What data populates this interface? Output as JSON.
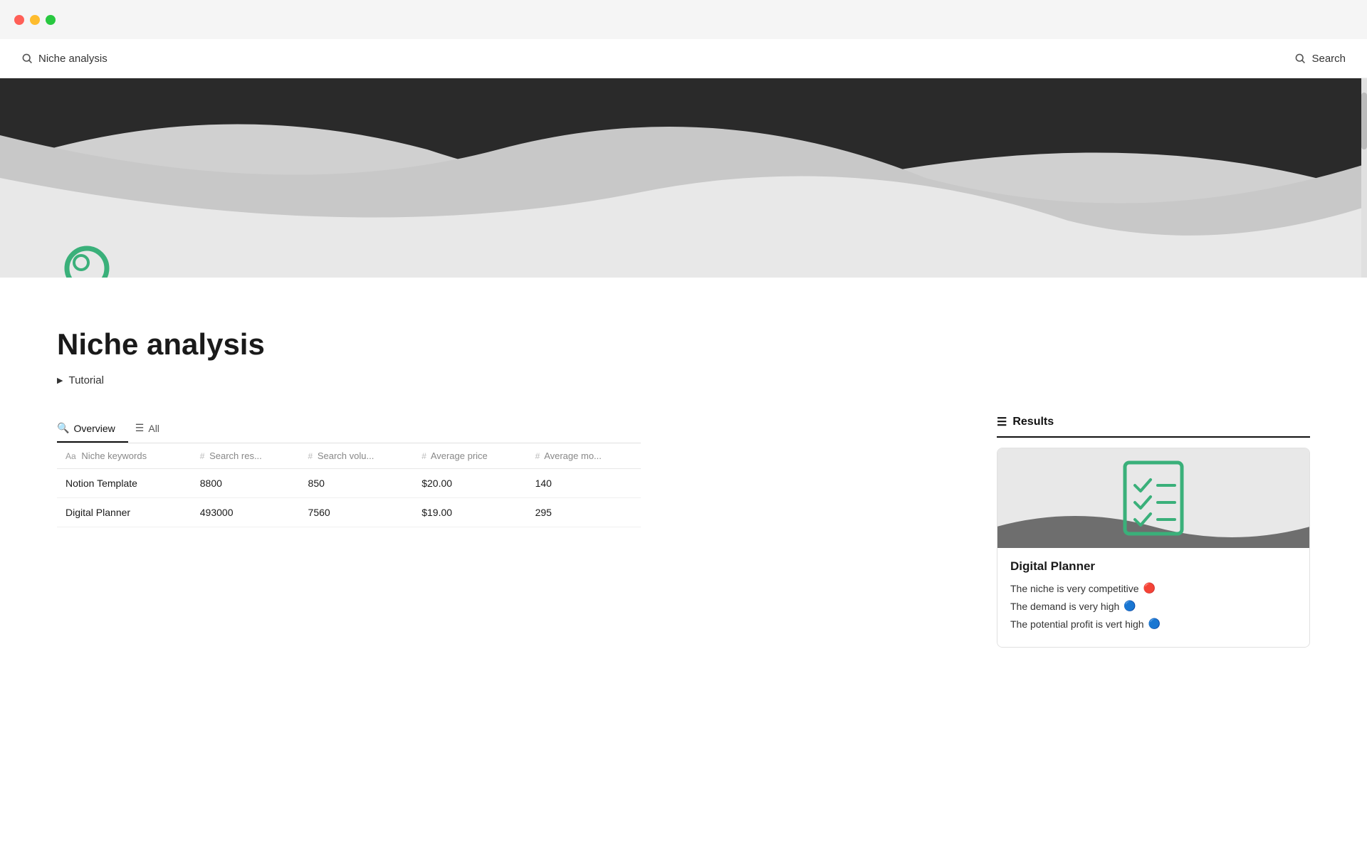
{
  "titlebar": {
    "traffic_lights": [
      "red",
      "yellow",
      "green"
    ]
  },
  "topnav": {
    "page_name": "Niche analysis",
    "search_label": "Search"
  },
  "page": {
    "title": "Niche analysis",
    "tutorial_label": "Tutorial"
  },
  "tabs": [
    {
      "label": "Overview",
      "icon": "🔍",
      "active": true
    },
    {
      "label": "All",
      "icon": "☰",
      "active": false
    }
  ],
  "table": {
    "columns": [
      {
        "prefix": "Aa",
        "label": "Niche keywords"
      },
      {
        "prefix": "#",
        "label": "Search res..."
      },
      {
        "prefix": "#",
        "label": "Search volu..."
      },
      {
        "prefix": "#",
        "label": "Average price"
      },
      {
        "prefix": "#",
        "label": "Average mo..."
      }
    ],
    "rows": [
      {
        "keyword": "Notion Template",
        "search_results": "8800",
        "search_volume": "850",
        "avg_price": "$20.00",
        "avg_monthly": "140"
      },
      {
        "keyword": "Digital Planner",
        "search_results": "493000",
        "search_volume": "7560",
        "avg_price": "$19.00",
        "avg_monthly": "295"
      }
    ]
  },
  "results": {
    "section_label": "Results",
    "card": {
      "title": "Digital Planner",
      "items": [
        {
          "text": "The niche is very competitive",
          "emoji": "🔴"
        },
        {
          "text": "The demand is very high",
          "emoji": "🔵"
        },
        {
          "text": "The potential profit is vert high",
          "emoji": "🔵"
        }
      ]
    }
  }
}
